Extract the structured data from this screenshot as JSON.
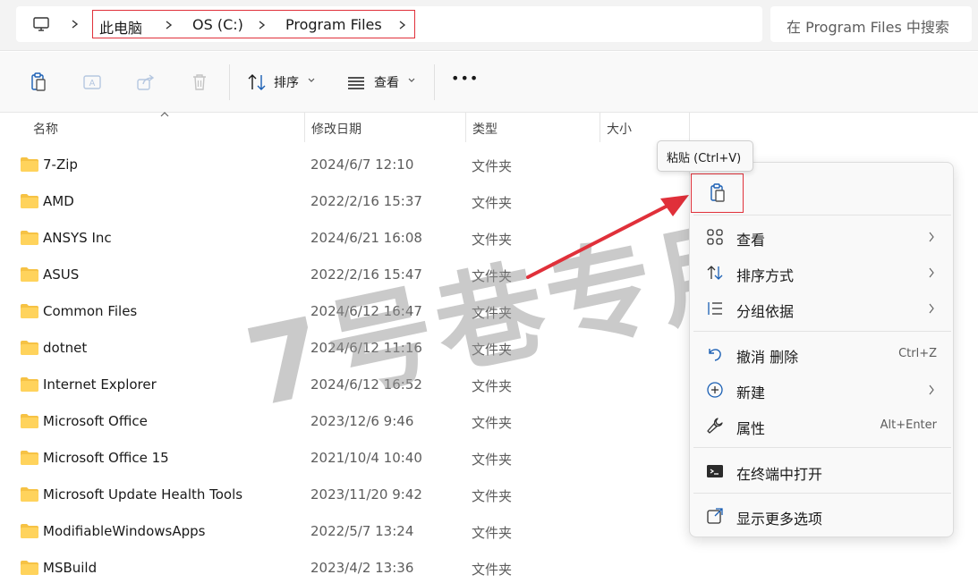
{
  "address_bar": {
    "breadcrumbs": [
      "此电脑",
      "OS (C:)",
      "Program Files"
    ]
  },
  "search": {
    "placeholder": "在 Program Files 中搜索"
  },
  "toolbar": {
    "sort_label": "排序",
    "view_label": "查看",
    "more_label": "•••"
  },
  "columns": {
    "name": "名称",
    "date": "修改日期",
    "type": "类型",
    "size": "大小"
  },
  "files": [
    {
      "name": "7-Zip",
      "date": "2024/6/7 12:10",
      "type": "文件夹"
    },
    {
      "name": "AMD",
      "date": "2022/2/16 15:37",
      "type": "文件夹"
    },
    {
      "name": "ANSYS Inc",
      "date": "2024/6/21 16:08",
      "type": "文件夹"
    },
    {
      "name": "ASUS",
      "date": "2022/2/16 15:47",
      "type": "文件夹"
    },
    {
      "name": "Common Files",
      "date": "2024/6/12 16:47",
      "type": "文件夹"
    },
    {
      "name": "dotnet",
      "date": "2024/6/12 11:16",
      "type": "文件夹"
    },
    {
      "name": "Internet Explorer",
      "date": "2024/6/12 16:52",
      "type": "文件夹"
    },
    {
      "name": "Microsoft Office",
      "date": "2023/12/6 9:46",
      "type": "文件夹"
    },
    {
      "name": "Microsoft Office 15",
      "date": "2021/10/4 10:40",
      "type": "文件夹"
    },
    {
      "name": "Microsoft Update Health Tools",
      "date": "2023/11/20 9:42",
      "type": "文件夹"
    },
    {
      "name": "ModifiableWindowsApps",
      "date": "2022/5/7 13:24",
      "type": "文件夹"
    },
    {
      "name": "MSBuild",
      "date": "2023/4/2 13:36",
      "type": "文件夹"
    }
  ],
  "tooltip": {
    "text": "粘贴 (Ctrl+V)"
  },
  "context_menu": {
    "items": [
      {
        "label": "查看",
        "icon": "grid-icon",
        "submenu": true
      },
      {
        "label": "排序方式",
        "icon": "sort-icon",
        "submenu": true
      },
      {
        "label": "分组依据",
        "icon": "group-icon",
        "submenu": true
      },
      {
        "label": "撤消 删除",
        "icon": "undo-icon",
        "shortcut": "Ctrl+Z"
      },
      {
        "label": "新建",
        "icon": "new-icon",
        "submenu": true
      },
      {
        "label": "属性",
        "icon": "wrench-icon",
        "shortcut": "Alt+Enter"
      },
      {
        "label": "在终端中打开",
        "icon": "terminal-icon"
      },
      {
        "label": "显示更多选项",
        "icon": "more-options-icon"
      }
    ]
  },
  "watermark": {
    "text": "7号巷专用"
  },
  "colors": {
    "accent": "#0067c0",
    "highlight": "#e0303a",
    "folder": "#f6c244"
  }
}
